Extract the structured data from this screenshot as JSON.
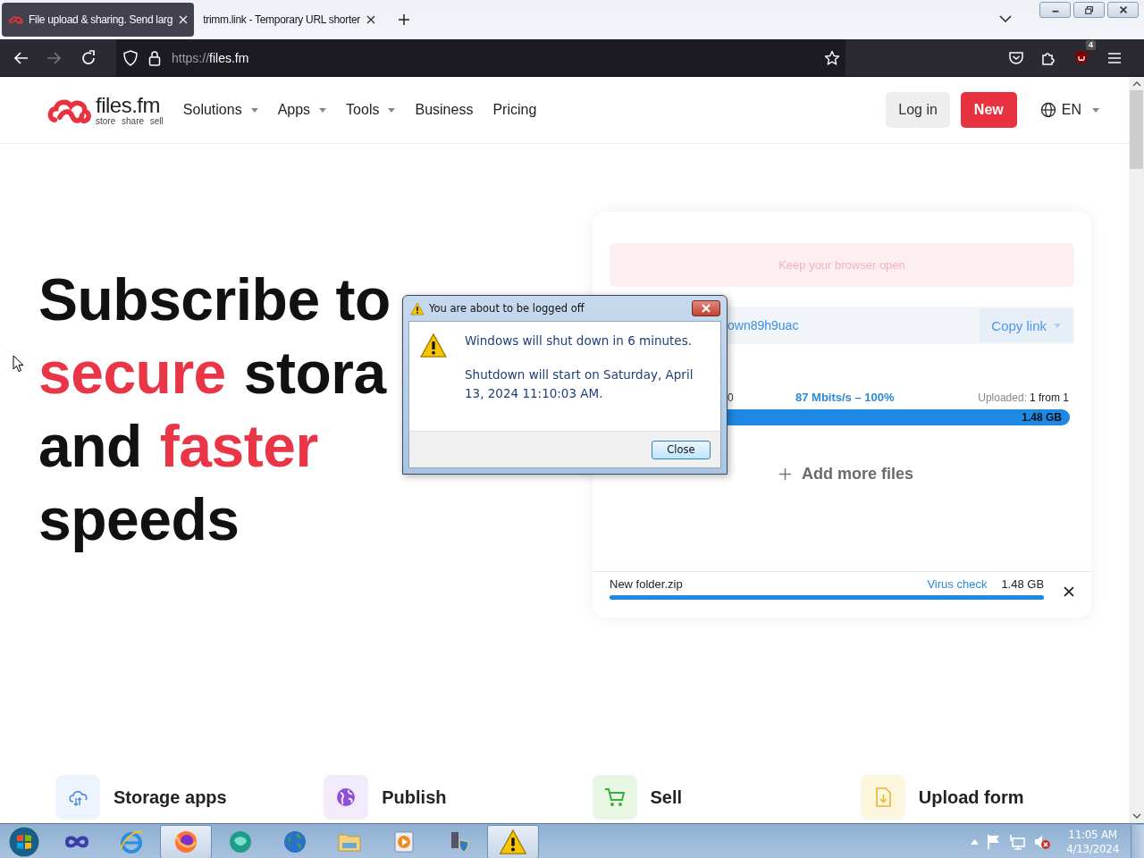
{
  "browser": {
    "tabs": [
      {
        "title": "File upload & sharing. Send larg",
        "selected": true,
        "has_icon": true
      },
      {
        "title": "trimm.link - Temporary URL shorter",
        "selected": false,
        "has_icon": false
      }
    ],
    "url_scheme": "https://",
    "url_host": "files.fm",
    "extension_badge": "4"
  },
  "site": {
    "logo_name": "files.fm",
    "logo_tagline": "store share sell",
    "nav": [
      {
        "label": "Solutions",
        "has_menu": true
      },
      {
        "label": "Apps",
        "has_menu": true
      },
      {
        "label": "Tools",
        "has_menu": true
      },
      {
        "label": "Business",
        "has_menu": false
      },
      {
        "label": "Pricing",
        "has_menu": false
      }
    ],
    "login": "Log in",
    "signup": "New",
    "language": "EN"
  },
  "hero": {
    "lines": [
      {
        "words": [
          {
            "text": "Subscribe to",
            "accent": false
          }
        ]
      },
      {
        "words": [
          {
            "text": "secure",
            "accent": true
          },
          {
            "text": "stora",
            "accent": false
          }
        ]
      },
      {
        "words": [
          {
            "text": "and",
            "accent": false
          },
          {
            "text": "faster",
            "accent": true
          }
        ]
      },
      {
        "words": [
          {
            "text": "speeds",
            "accent": false
          }
        ]
      }
    ]
  },
  "upload_card": {
    "notice": "Keep your browser open",
    "link_text": "own89h9uac",
    "copy_button": "Copy link",
    "elapsed": "0",
    "speed": "87 Mbits/s – 100%",
    "uploaded_label": "Uploaded:",
    "uploaded_value": "1 from 1",
    "total": {
      "level": 1,
      "size": "1.48 GB"
    },
    "add_more": "Add more files",
    "file": {
      "name": "New folder.zip",
      "virus_check": "Virus check",
      "size": "1.48 GB",
      "level": 1
    }
  },
  "features": [
    {
      "label": "Storage apps",
      "kind": "cloud"
    },
    {
      "label": "Publish",
      "kind": "globe"
    },
    {
      "label": "Sell",
      "kind": "cart"
    },
    {
      "label": "Upload form",
      "kind": "file"
    }
  ],
  "dialog": {
    "title": "You are about to be logged off",
    "message": "Windows will shut down in 6 minutes.",
    "detail": "Shutdown will start on Saturday, April 13, 2024 11:10:03 AM.",
    "button": "Close"
  },
  "taskbar": {
    "apps": [
      {
        "kind": "infinity",
        "selected": false
      },
      {
        "kind": "ie",
        "selected": false
      },
      {
        "kind": "firefox",
        "selected": true
      },
      {
        "kind": "teal",
        "selected": false
      },
      {
        "kind": "globe",
        "selected": false
      },
      {
        "kind": "folder",
        "selected": false
      },
      {
        "kind": "media",
        "selected": false
      },
      {
        "kind": "admin",
        "selected": false
      },
      {
        "kind": "warning",
        "selected": true
      }
    ],
    "time": "11:05 AM",
    "date": "4/13/2024"
  }
}
